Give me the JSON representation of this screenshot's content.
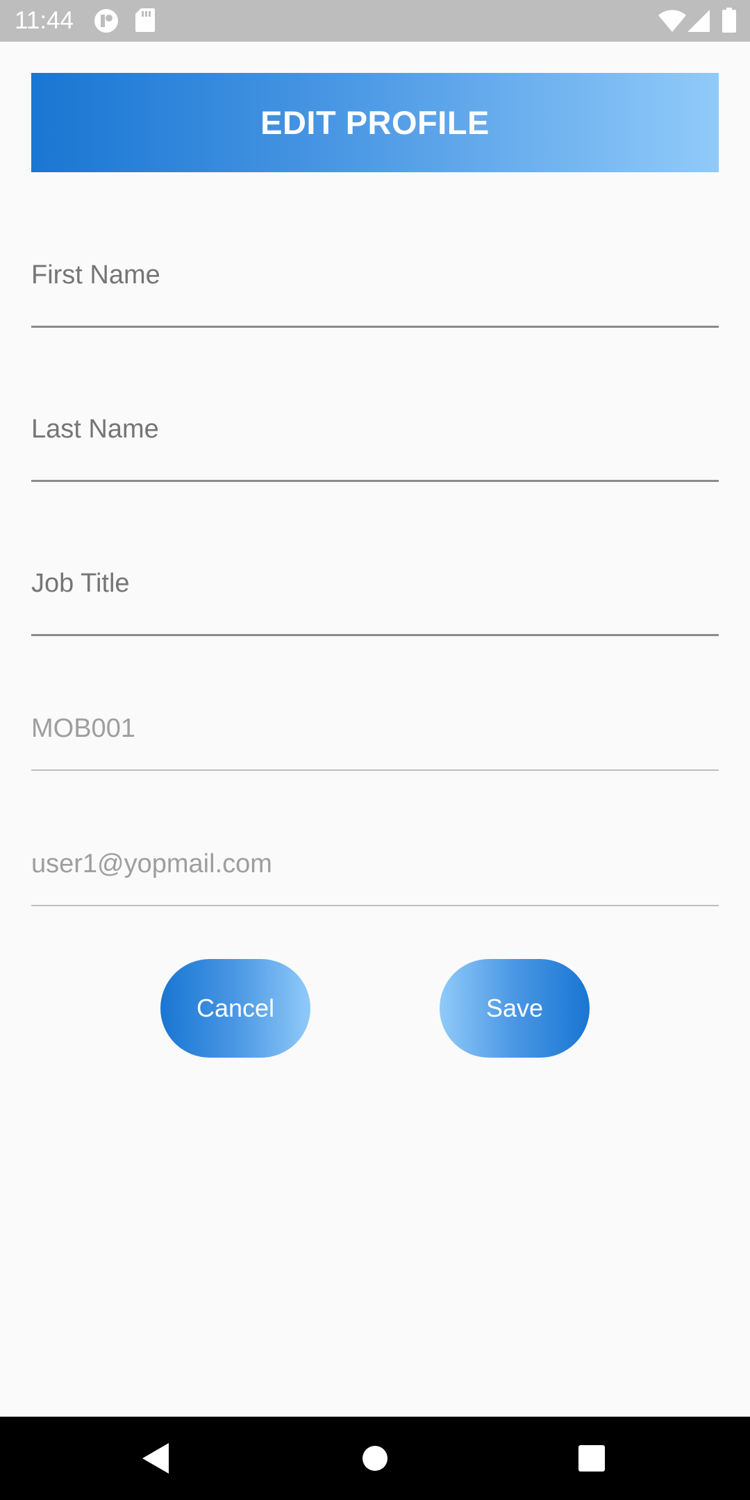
{
  "status_bar": {
    "time": "11:44",
    "left_icons": [
      "app-notification-icon",
      "sd-card-icon"
    ],
    "right_icons": [
      "wifi-icon",
      "cellular-signal-icon",
      "battery-icon"
    ],
    "background": "#bdbdbd"
  },
  "header": {
    "title": "EDIT PROFILE",
    "gradient_start": "#1976d2",
    "gradient_end": "#90caf9"
  },
  "form": {
    "first_name": {
      "placeholder": "First Name",
      "value": ""
    },
    "last_name": {
      "placeholder": "Last Name",
      "value": ""
    },
    "job_title": {
      "placeholder": "Job Title",
      "value": ""
    },
    "employee_id": {
      "value": "MOB001",
      "editable": false
    },
    "email": {
      "value": "user1@yopmail.com",
      "editable": false
    }
  },
  "buttons": {
    "cancel_label": "Cancel",
    "save_label": "Save"
  },
  "nav_bar": {
    "icons": [
      "back-icon",
      "home-icon",
      "recents-icon"
    ]
  }
}
